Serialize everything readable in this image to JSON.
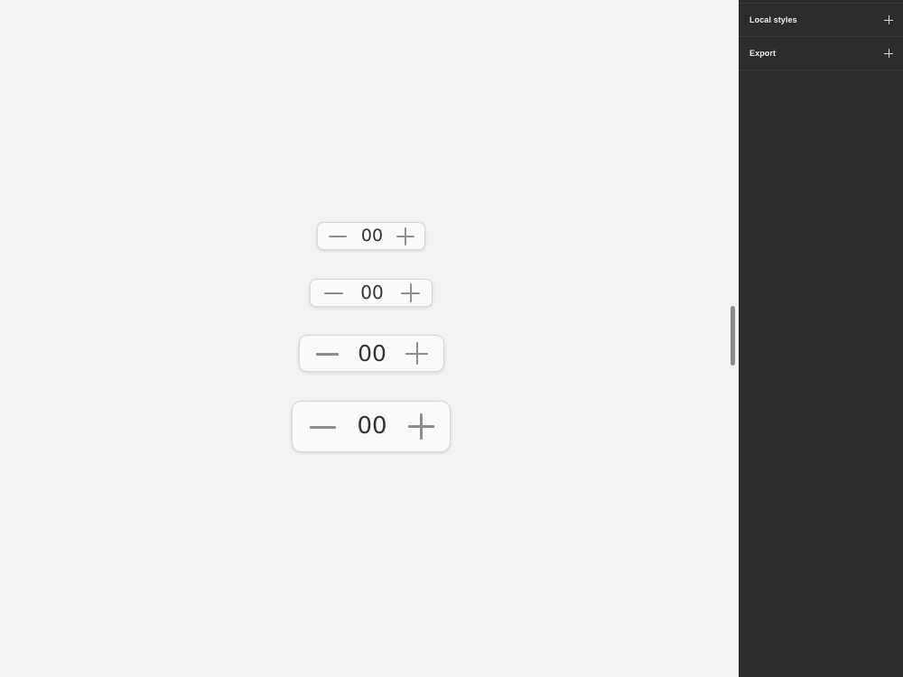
{
  "canvas": {
    "steppers": [
      {
        "value": "00",
        "decrement_icon": "minus-icon",
        "increment_icon": "plus-icon"
      },
      {
        "value": "00",
        "decrement_icon": "minus-icon",
        "increment_icon": "plus-icon"
      },
      {
        "value": "00",
        "decrement_icon": "minus-icon",
        "increment_icon": "plus-icon"
      },
      {
        "value": "00",
        "decrement_icon": "minus-icon",
        "increment_icon": "plus-icon"
      }
    ]
  },
  "right_panel": {
    "sections": [
      {
        "label": "Local styles",
        "action_icon": "plus-icon"
      },
      {
        "label": "Export",
        "action_icon": "plus-icon"
      }
    ]
  },
  "colors": {
    "canvas_background": "#f2f2f2",
    "panel_background": "#2c2c2c",
    "stepper_background": "#fafaf8",
    "stepper_icon": "#8e8c93",
    "stepper_text": "#333333"
  }
}
